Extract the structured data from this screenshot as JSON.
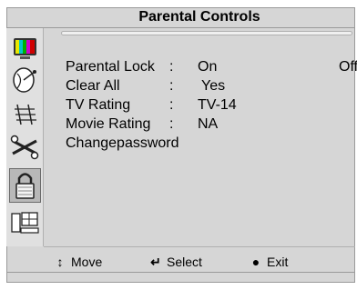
{
  "window": {
    "title": "Parental Controls"
  },
  "sidebar": {
    "icons": [
      {
        "name": "tv-color-bars-icon"
      },
      {
        "name": "satellite-dish-icon"
      },
      {
        "name": "antenna-icon"
      },
      {
        "name": "tools-icon"
      },
      {
        "name": "padlock-icon",
        "selected": true
      },
      {
        "name": "computer-setup-icon"
      }
    ]
  },
  "menu": {
    "rows": [
      {
        "label": "Parental Lock",
        "colon": ":",
        "value": "On",
        "alt": "Off"
      },
      {
        "label": "Clear All",
        "colon": ":",
        "value": "Yes"
      },
      {
        "label": "TV Rating",
        "colon": ":",
        "value": "TV-14"
      },
      {
        "label": "Movie Rating",
        "colon": ":",
        "value": "NA"
      },
      {
        "label": "Changepassword"
      }
    ]
  },
  "footer": {
    "move": {
      "glyph": "↕",
      "label": "Move"
    },
    "select": {
      "glyph": "↵",
      "label": "Select"
    },
    "exit": {
      "glyph": "●",
      "label": "Exit"
    }
  }
}
